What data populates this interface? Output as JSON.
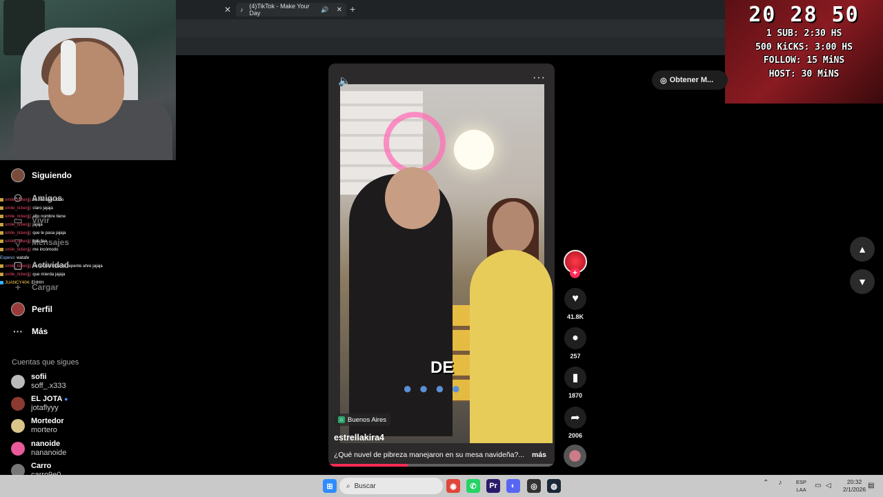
{
  "browser": {
    "tab_title": "(4)TikTok - Make Your Day",
    "tab_icon": "tiktok-icon"
  },
  "goals": {
    "counter": "20 28 50",
    "lines": [
      "1 SUB: 2:30 HS",
      "500 KiCKS: 3:00 HS",
      "FOLLOW: 15 MiNS",
      "HOST: 30 MiNS"
    ]
  },
  "sidebar": {
    "items": [
      {
        "label": "Siguiendo",
        "icon": "avatar-icon"
      },
      {
        "label": "Amigos",
        "icon": "friends-icon"
      },
      {
        "label": "Vivir",
        "icon": "live-icon"
      },
      {
        "label": "Mensajes",
        "icon": "message-icon"
      },
      {
        "label": "Actividad",
        "icon": "activity-icon"
      },
      {
        "label": "Cargar",
        "icon": "upload-icon"
      },
      {
        "label": "Perfil",
        "icon": "profile-icon"
      },
      {
        "label": "Más",
        "icon": "more-icon"
      }
    ],
    "following_title": "Cuentas que sigues",
    "accounts": [
      {
        "name": "sofii",
        "handle": "soff_.x333"
      },
      {
        "name": "EL JOTA",
        "handle": "jotaflyyy"
      },
      {
        "name": "Mortedor",
        "handle": "mortero"
      },
      {
        "name": "nanoide",
        "handle": "nananoide"
      },
      {
        "name": "Carro",
        "handle": "carro9e0"
      }
    ]
  },
  "chat": [
    {
      "user": "smile_tickerjjj",
      "msg": "se me sallo todo"
    },
    {
      "user": "smile_tickerjjj",
      "msg": "claro jajaja"
    },
    {
      "user": "smile_tickerjjj",
      "msg": "alto nombre tiene"
    },
    {
      "user": "smile_tickerjjj",
      "msg": "jajaja"
    },
    {
      "user": "smile_tickerjjj",
      "msg": "que le pasa jajaja"
    },
    {
      "user": "smile_tickerjjj",
      "msg": "que feo"
    },
    {
      "user": "smile_tickerjjj",
      "msg": "me incómodo"
    },
    {
      "user": "Espeso",
      "msg": "watafe"
    },
    {
      "user": "smile_tickerjjj",
      "msg": "no tenían ropa de repente ahre jajaja"
    },
    {
      "user": "smile_tickerjjj",
      "msg": "que mierda jajaja"
    },
    {
      "user": "JUANCY404",
      "msg": "EHHH"
    }
  ],
  "video": {
    "caption_word": "DE",
    "location": "Buenos Aires",
    "author": "estrellakira4",
    "description": "¿Qué nuvel de pibreza manejaron en su mesa navideña?...",
    "more_label": "más",
    "progress": 0.35
  },
  "actions": {
    "likes": "41.8K",
    "comments": "257",
    "saves": "1870",
    "shares": "2006"
  },
  "get_app_label": "Obtener M...",
  "taskbar": {
    "search_placeholder": "Buscar",
    "lang_1": "ESP",
    "lang_2": "LAA",
    "time": "20:32",
    "date": "2/1/2026"
  }
}
